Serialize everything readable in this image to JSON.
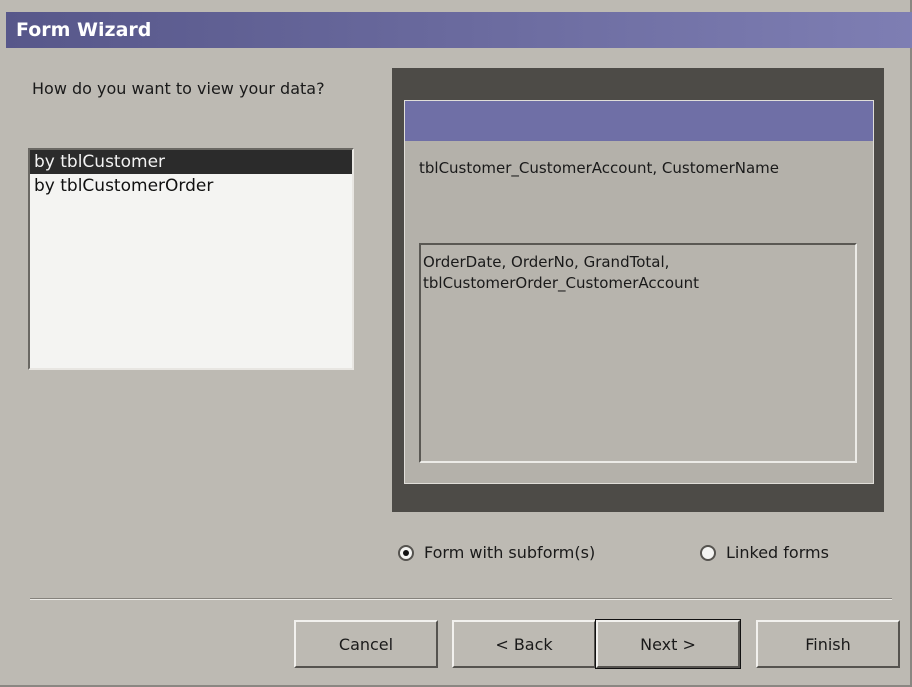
{
  "window": {
    "title": "Form Wizard"
  },
  "prompt": "How do you want to view your data?",
  "view_options": [
    {
      "label": "by tblCustomer",
      "selected": true
    },
    {
      "label": "by tblCustomerOrder",
      "selected": false
    }
  ],
  "preview": {
    "main_fields": "tblCustomer_CustomerAccount, CustomerName",
    "sub_fields_line1": "OrderDate, OrderNo, GrandTotal,",
    "sub_fields_line2": "tblCustomerOrder_CustomerAccount"
  },
  "layout_options": {
    "form_with_subform": {
      "label": "Form with subform(s)",
      "selected": true
    },
    "linked_forms": {
      "label": "Linked forms",
      "selected": false
    }
  },
  "buttons": {
    "cancel": "Cancel",
    "back": "< Back",
    "next": "Next >",
    "finish": "Finish"
  },
  "colors": {
    "dialog_bg": "#bdbab3",
    "titlebar": "#6a6a9e",
    "selection": "#2b2b2b"
  }
}
